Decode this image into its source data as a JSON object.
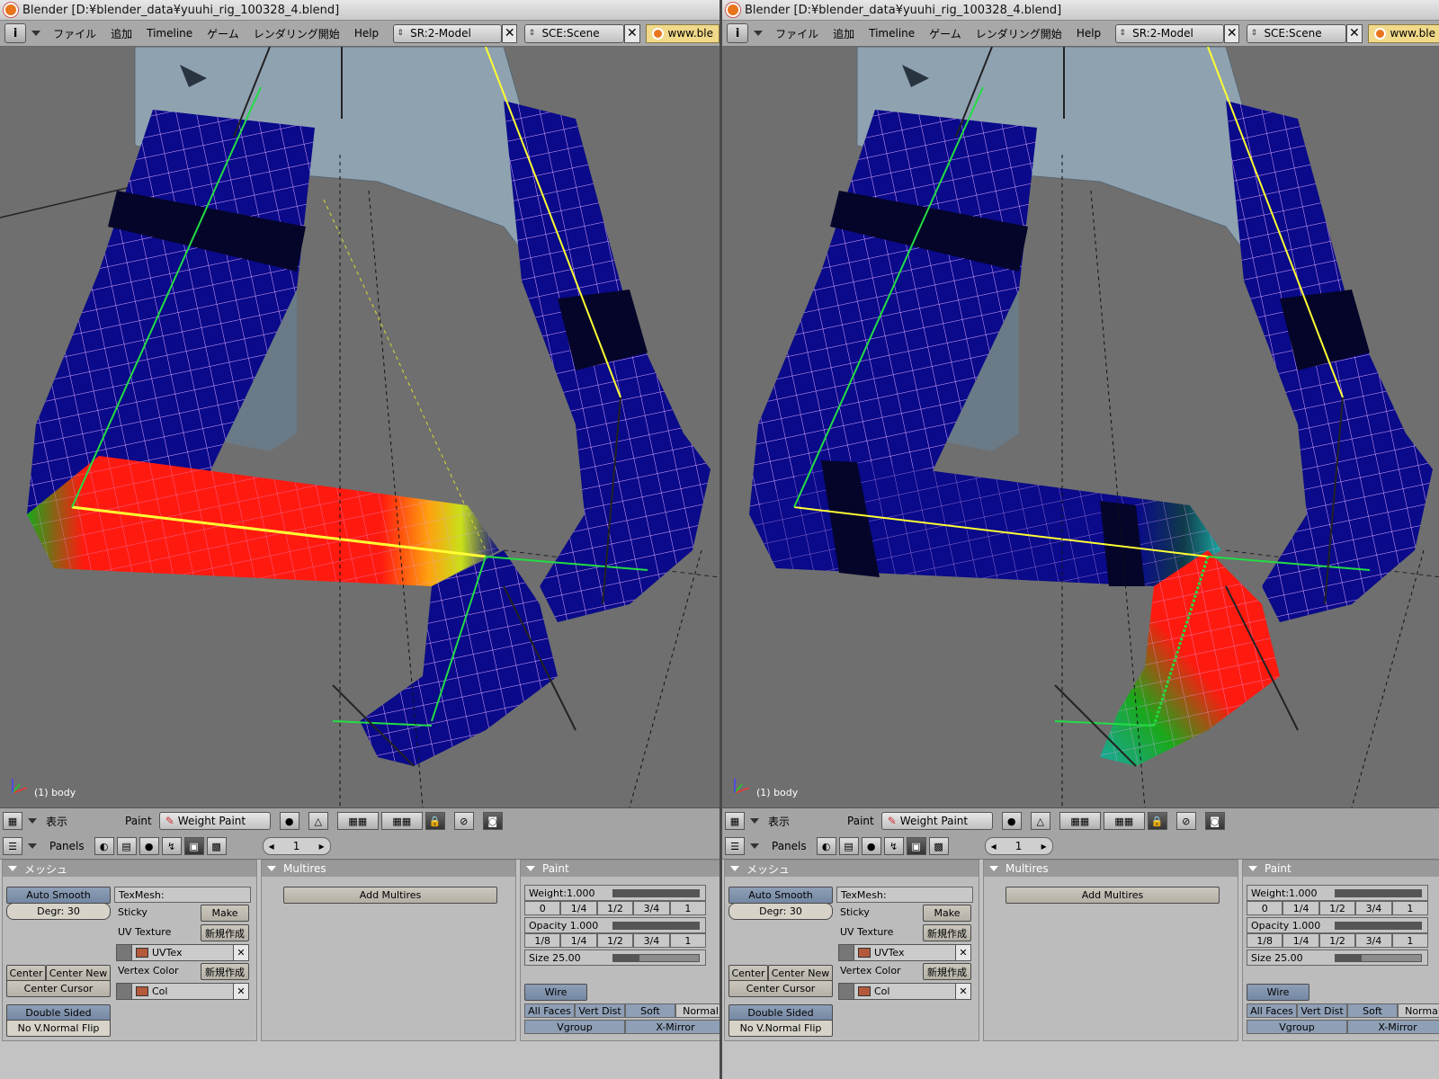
{
  "window": {
    "title": "Blender [D:¥blender_data¥yuuhi_rig_100328_4.blend]"
  },
  "menu": {
    "items": [
      "ファイル",
      "追加",
      "Timeline",
      "ゲーム",
      "レンダリング開始",
      "Help"
    ],
    "screen_value": "SR:2-Model",
    "scene_value": "SCE:Scene",
    "url_text": "www.ble"
  },
  "viewport": {
    "object_label": "(1) body"
  },
  "toolbar": {
    "view_label": "表示",
    "mode_label": "Paint",
    "mode_value": "Weight Paint"
  },
  "panelsbar": {
    "label": "Panels",
    "frame_value": "1"
  },
  "mesh_panel": {
    "title": "メッシュ",
    "auto_smooth": "Auto Smooth",
    "degr": "Degr: 30",
    "center": "Center",
    "center_new": "Center New",
    "center_cursor": "Center Cursor",
    "double_sided": "Double Sided",
    "no_vnormal_flip": "No V.Normal Flip",
    "texmesh": "TexMesh:",
    "sticky": "Sticky",
    "make": "Make",
    "uv_texture": "UV Texture",
    "new_btn": "新規作成",
    "uvtex": "UVTex",
    "vertex_color": "Vertex Color",
    "col": "Col"
  },
  "multires_panel": {
    "title": "Multires",
    "add_multires": "Add Multires"
  },
  "paint_panel": {
    "title": "Paint",
    "weight": "Weight:1.000",
    "weight_fraction": 1.0,
    "fractions": [
      "0",
      "1/4",
      "1/2",
      "3/4",
      "1"
    ],
    "opacity": "Opacity 1.000",
    "opacity_fraction": 1.0,
    "fractions2": [
      "1/8",
      "1/4",
      "1/2",
      "3/4",
      "1"
    ],
    "size": "Size 25.00",
    "size_fraction": 0.3,
    "wire": "Wire",
    "options": [
      "All Faces",
      "Vert Dist",
      "Soft",
      "Normal"
    ],
    "vgroup": "Vgroup",
    "xmirror": "X-Mirror"
  },
  "colors": {
    "mesh_blue": "#0a0a8a",
    "weight_red": "#ff1a10",
    "weight_green": "#1aa81a",
    "cloth": "#8fa2b0",
    "bone_green": "#22dd44",
    "bone_yellow": "#ffff33"
  }
}
